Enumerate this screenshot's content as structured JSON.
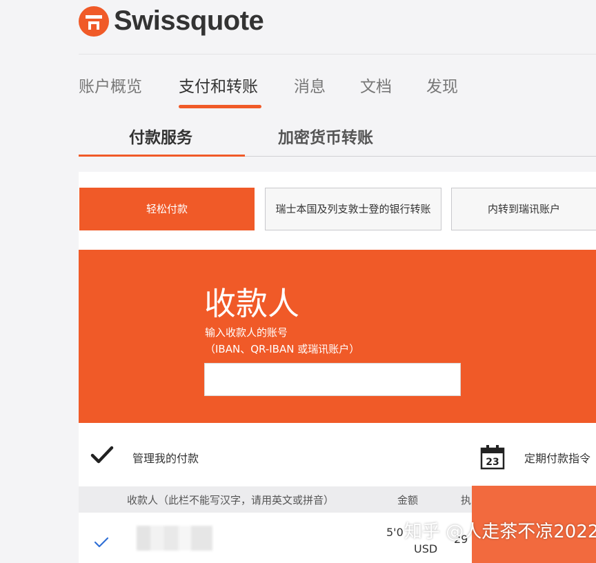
{
  "brand": {
    "name": "Swissquote",
    "color": "#f05a28"
  },
  "nav": {
    "items": [
      {
        "label": "账户概览"
      },
      {
        "label": "支付和转账"
      },
      {
        "label": "消息"
      },
      {
        "label": "文档"
      },
      {
        "label": "发现"
      }
    ],
    "active_index": 1
  },
  "subtabs": [
    {
      "label": "付款服务"
    },
    {
      "label": "加密货币转账"
    }
  ],
  "payment_types": [
    {
      "label": "轻松付款"
    },
    {
      "label": "瑞士本国及列支敦士登的银行转账"
    },
    {
      "label": "内转到瑞讯账户"
    }
  ],
  "hero": {
    "title": "收款人",
    "subtitle_line1": "输入收款人的账号",
    "subtitle_line2": "（IBAN、QR-IBAN 或瑞讯账户）",
    "input_value": ""
  },
  "actions": {
    "manage_label": "管理我的付款",
    "calendar_day": "23",
    "scheduled_label": "定期付款指令"
  },
  "table": {
    "headers": [
      "收款人（此栏不能写汉字，请用英文或拼音）",
      "金额",
      "执"
    ],
    "rows": [
      {
        "amount": "5'0",
        "currency": "USD",
        "date": "29"
      }
    ]
  },
  "watermark": "知乎 @人走茶不凉2022"
}
